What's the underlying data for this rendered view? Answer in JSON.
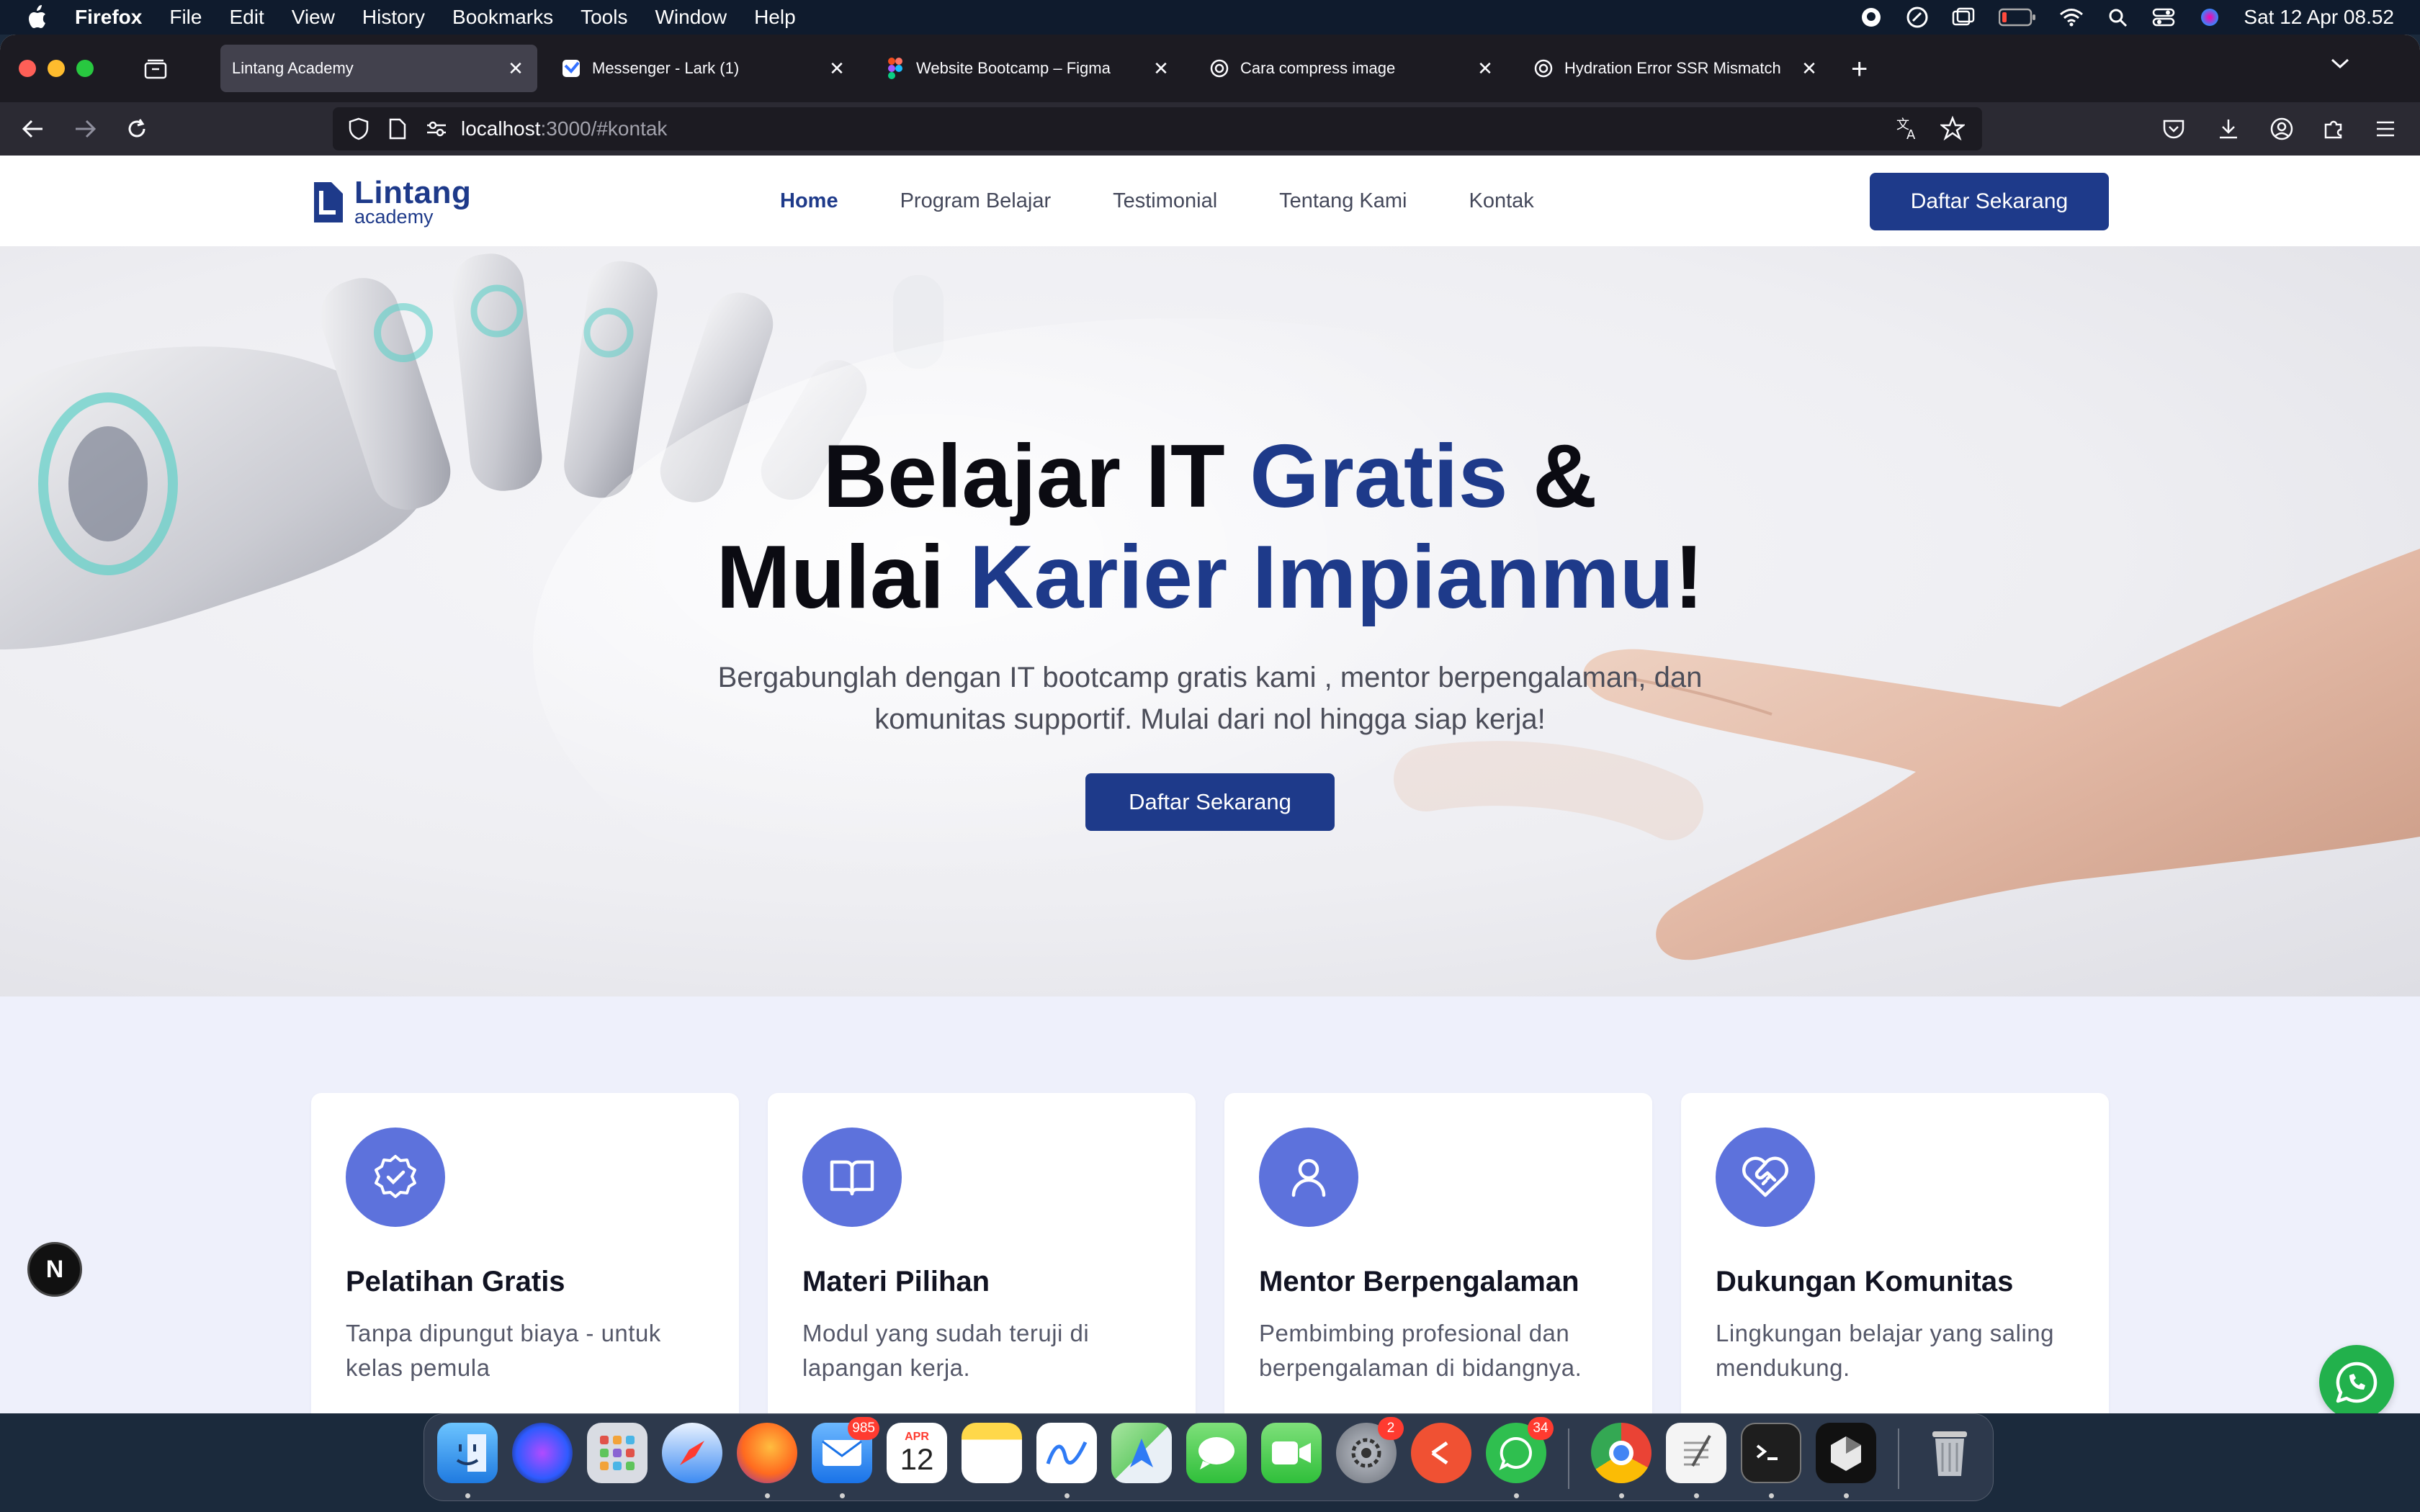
{
  "menubar": {
    "app": "Firefox",
    "items": [
      "File",
      "Edit",
      "View",
      "History",
      "Bookmarks",
      "Tools",
      "Window",
      "Help"
    ],
    "datetime": "Sat 12 Apr  08.52"
  },
  "browser": {
    "tabs": [
      {
        "title": "Lintang Academy",
        "active": true
      },
      {
        "title": "Messenger - Lark (1)",
        "active": false
      },
      {
        "title": "Website Bootcamp – Figma",
        "active": false
      },
      {
        "title": "Cara compress image",
        "active": false
      },
      {
        "title": "Hydration Error SSR Mismatch",
        "active": false
      }
    ],
    "url_host": "localhost",
    "url_path": ":3000/#kontak"
  },
  "site": {
    "logo": {
      "name": "Lintang",
      "sub": "academy"
    },
    "nav": [
      "Home",
      "Program Belajar",
      "Testimonial",
      "Tentang Kami",
      "Kontak"
    ],
    "header_cta": "Daftar Sekarang",
    "hero": {
      "line1_a": "Belajar IT ",
      "line1_b": "Gratis",
      "line1_c": " &",
      "line2_a": "Mulai ",
      "line2_b": "Karier Impianmu",
      "line2_c": "!",
      "subtitle": "Bergabunglah dengan IT bootcamp gratis kami , mentor berpengalaman, dan komunitas supportif. Mulai dari nol hingga siap kerja!",
      "cta": "Daftar Sekarang"
    },
    "features": [
      {
        "title": "Pelatihan Gratis",
        "desc": "Tanpa dipungut biaya - untuk kelas pemula",
        "icon": "badge-check-icon"
      },
      {
        "title": "Materi Pilihan",
        "desc": "Modul yang sudah teruji di lapangan kerja.",
        "icon": "book-open-icon"
      },
      {
        "title": "Mentor Berpengalaman",
        "desc": "Pembimbing profesional dan berpengalaman di bidangnya.",
        "icon": "user-icon"
      },
      {
        "title": "Dukungan Komunitas",
        "desc": "Lingkungan belajar yang saling mendukung.",
        "icon": "heart-handshake-icon"
      }
    ]
  },
  "overlay": {
    "next_badge": "N"
  },
  "dock": {
    "apps": [
      "Finder",
      "Siri",
      "Launchpad",
      "Safari",
      "Firefox",
      "Mail",
      "Calendar",
      "Notes",
      "Freeform",
      "Maps",
      "Messages",
      "FaceTime",
      "System Settings",
      "Git Client",
      "WhatsApp",
      "Chrome",
      "TextEdit",
      "Terminal",
      "Cursor",
      "Trash"
    ],
    "mail_badge": "985",
    "settings_badge": "2",
    "whatsapp_badge": "34",
    "calendar_month": "APR",
    "calendar_day": "12"
  },
  "colors": {
    "brand": "#1e3a8a",
    "icon_bg": "#5d72dc",
    "whatsapp": "#22b14c"
  }
}
